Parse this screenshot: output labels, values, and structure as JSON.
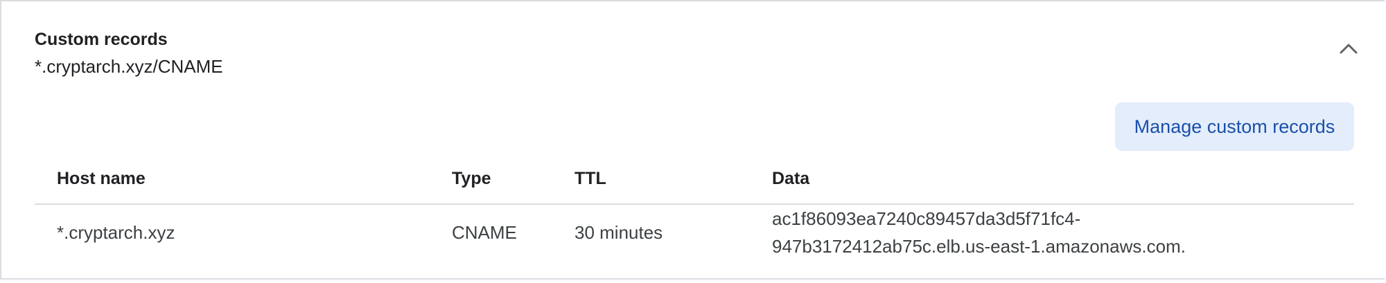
{
  "section": {
    "title": "Custom records",
    "subtitle": "*.cryptarch.xyz/CNAME",
    "collapse_icon": "chevron-up-icon"
  },
  "actions": {
    "manage_label": "Manage custom records"
  },
  "table": {
    "columns": [
      "Host name",
      "Type",
      "TTL",
      "Data"
    ],
    "rows": [
      {
        "host": "*.cryptarch.xyz",
        "type": "CNAME",
        "ttl": "30 minutes",
        "data_line1": "ac1f86093ea7240c89457da3d5f71fc4-",
        "data_line2": "947b3172412ab75c.elb.us-east-1.amazonaws.com."
      }
    ]
  },
  "colors": {
    "accent": "#1a4fa8",
    "button_bg": "#e3edfc",
    "divider": "#dadce0"
  }
}
